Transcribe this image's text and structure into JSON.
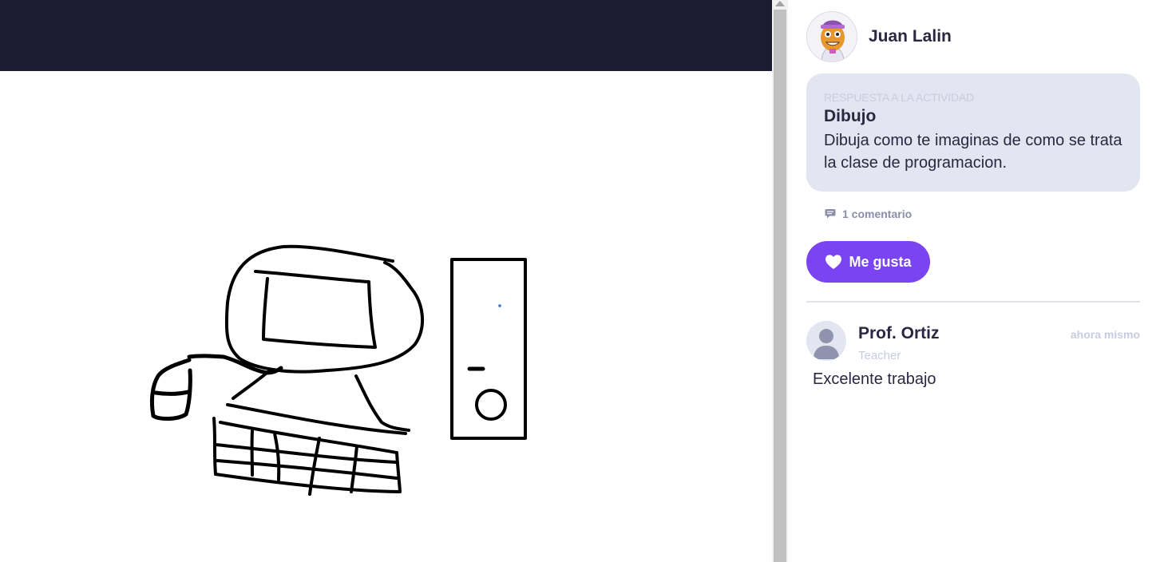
{
  "post": {
    "author_name": "Juan Lalin",
    "activity_kicker": "RESPUESTA A LA ACTIVIDAD",
    "activity_title": "Dibujo",
    "activity_description": "Dibuja como te imaginas de como se trata la clase de programacion.",
    "comment_count_label": "1 comentario",
    "like_label": "Me gusta"
  },
  "comments": [
    {
      "author": "Prof. Ortiz",
      "role": "Teacher",
      "time": "ahora mismo",
      "text": "Excelente trabajo"
    }
  ],
  "icons": {
    "comment": "speech-bubble-icon",
    "like": "heart-icon",
    "author_avatar": "monster-avatar",
    "commenter_avatar": "person-silhouette-icon"
  },
  "colors": {
    "header": "#1d1b31",
    "accent": "#7b44f2",
    "card": "#e3e5f1",
    "text": "#2a2740",
    "muted": "#8a8ca8"
  }
}
